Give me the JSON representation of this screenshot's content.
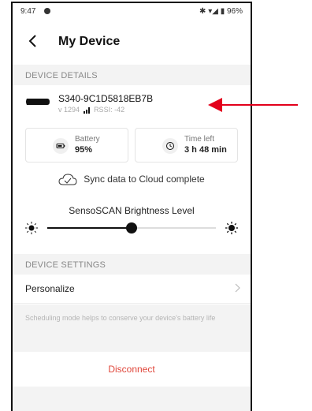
{
  "status_bar": {
    "time": "9:47",
    "right": "✱ ▾◢ ▮ 96%"
  },
  "header": {
    "title": "My Device"
  },
  "device_details": {
    "section_title": "DEVICE DETAILS",
    "device_name": "S340-9C1D5818EB7B",
    "version": "v 1294",
    "rssi": "RSSI: -42"
  },
  "cards": {
    "battery": {
      "label": "Battery",
      "value": "95%"
    },
    "time_left": {
      "label": "Time left",
      "value": "3 h 48 min"
    }
  },
  "sync": {
    "text": "Sync data to Cloud complete"
  },
  "brightness": {
    "label": "SensoSCAN Brightness Level",
    "level": 0.5
  },
  "device_settings": {
    "section_title": "DEVICE SETTINGS",
    "personalize": "Personalize",
    "info": "Scheduling mode helps to conserve your device's battery life"
  },
  "disconnect": {
    "label": "Disconnect"
  },
  "colors": {
    "accent": "#e0463a",
    "annotation_arrow": "#e3001b"
  }
}
